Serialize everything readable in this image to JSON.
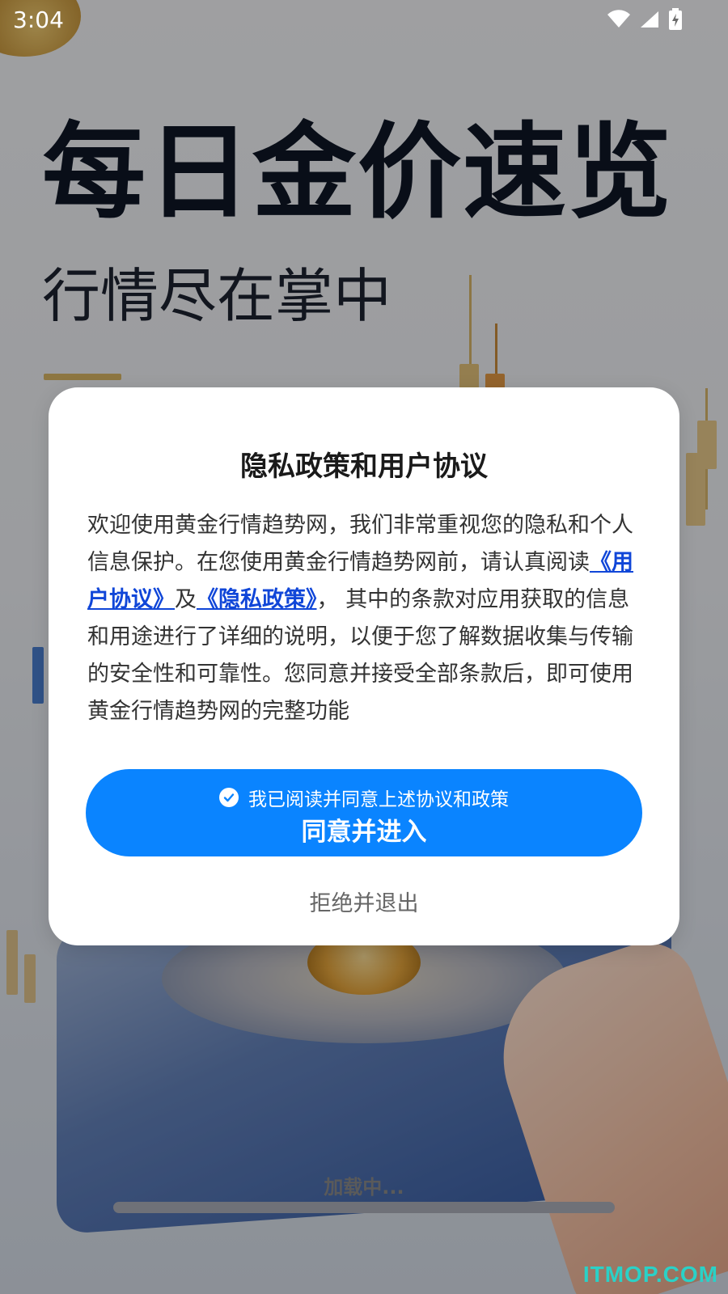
{
  "status_bar": {
    "time": "3:04",
    "icons": [
      "wifi-icon",
      "signal-icon",
      "battery-charging-icon"
    ]
  },
  "splash": {
    "title": "每日金价速览",
    "subtitle": "行情尽在掌中",
    "loading_text": "加载中..."
  },
  "dialog": {
    "title": "隐私政策和用户协议",
    "body_prefix": "欢迎使用黄金行情趋势网，我们非常重视您的隐私和个人信息保护。在您使用黄金行情趋势网前，请认真阅读",
    "user_agreement_link": "《用户协议》",
    "conjunction": "及",
    "privacy_policy_link": "《隐私政策》",
    "body_suffix": "， 其中的条款对应用获取的信息和用途进行了详细的说明，以便于您了解数据收集与传输的安全性和可靠性。您同意并接受全部条款后，即可使用黄金行情趋势网的完整功能",
    "checkbox_label": "我已阅读并同意上述协议和政策",
    "checkbox_checked": true,
    "agree_button_label": "同意并进入",
    "reject_button_label": "拒绝并退出"
  },
  "watermark": "ITMOP.COM",
  "colors": {
    "primary_button": "#0a84ff",
    "link": "#1046d8",
    "watermark": "#2ad1c7"
  }
}
